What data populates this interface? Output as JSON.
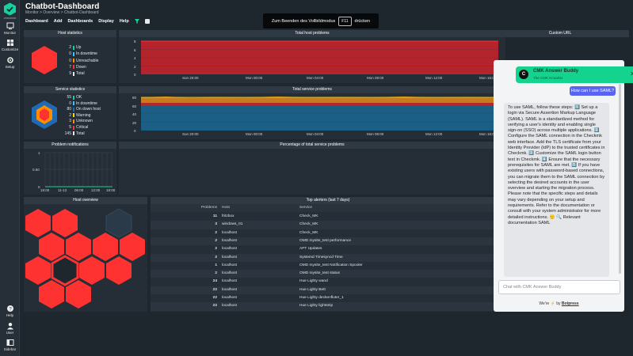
{
  "app": {
    "logo_text": "checkmk",
    "nav": [
      {
        "label": "Monitor",
        "icon": "monitor-icon"
      },
      {
        "label": "Customize",
        "icon": "customize-icon"
      },
      {
        "label": "Setup",
        "icon": "setup-icon"
      },
      {
        "label": "Help",
        "icon": "help-icon"
      },
      {
        "label": "User",
        "icon": "user-icon"
      },
      {
        "label": "Sidebar",
        "icon": "sidebar-icon"
      }
    ]
  },
  "header": {
    "title": "Chatbot-Dashboard",
    "breadcrumb": "Monitor > Overview > Chatbot-Dashboard",
    "menu": [
      "Dashboard",
      "Add",
      "Dashboards",
      "Display",
      "Help"
    ]
  },
  "fullscreen": {
    "before": "Zum Beenden des Vollbildmodus",
    "key": "F11",
    "after": "drücken"
  },
  "host_stats": {
    "title": "Host statistics",
    "rows": [
      {
        "num": "2",
        "label": "Up",
        "color": "#13d38e"
      },
      {
        "num": "0",
        "label": "In downtime",
        "color": "#3cc2ff"
      },
      {
        "num": "0",
        "label": "Unreachable",
        "color": "#ff8d00"
      },
      {
        "num": "7",
        "label": "Down",
        "color": "#ff3232"
      },
      {
        "num": "9",
        "label": "Total",
        "color": "#e8e8e8"
      }
    ]
  },
  "service_stats": {
    "title": "Service statistics",
    "rows": [
      {
        "num": "55",
        "label": "OK",
        "color": "#13d38e"
      },
      {
        "num": "0",
        "label": "In downtime",
        "color": "#3cc2ff"
      },
      {
        "num": "80",
        "label": "On down host",
        "color": "#1d6bb5"
      },
      {
        "num": "2",
        "label": "Warning",
        "color": "#ffd703"
      },
      {
        "num": "3",
        "label": "Unknown",
        "color": "#ff8d00"
      },
      {
        "num": "5",
        "label": "Critical",
        "color": "#ff3232"
      },
      {
        "num": "145",
        "label": "Total",
        "color": "#e8e8e8"
      }
    ]
  },
  "total_host": {
    "title": "Total host problems",
    "yticks": [
      "8",
      "6",
      "4",
      "2",
      "0"
    ],
    "xticks": [
      "Sun 20:00",
      "Mon 00:00",
      "Mon 04:00",
      "Mon 08:00",
      "Mon 12:00",
      "Mon 16:00"
    ]
  },
  "total_service": {
    "title": "Total service problems",
    "yticks": [
      "80",
      "60",
      "40",
      "20",
      "0"
    ],
    "xticks": [
      "Sun 20:00",
      "Mon 00:00",
      "Mon 04:00",
      "Mon 08:00",
      "Mon 12:00",
      "Mon 16:00"
    ]
  },
  "problem_notifications": {
    "title": "Problem notifications",
    "yticks": [
      "1",
      "0.50",
      "0"
    ],
    "xticks": [
      "18:00",
      "11-13",
      "06:00",
      "12:00",
      "18:00"
    ]
  },
  "percentage": {
    "title": "Percentage of total service problems"
  },
  "host_overview": {
    "title": "Host overview"
  },
  "custom_url": {
    "title": "Custom URL"
  },
  "top_alerters": {
    "title": "Top alerters (last 7 days)",
    "columns": [
      "Problems",
      "Host",
      "Service"
    ],
    "rows": [
      [
        "11",
        "fritzbox",
        "Check_MK"
      ],
      [
        "3",
        "windows_01",
        "Check_MK"
      ],
      [
        "2",
        "localhost",
        "Check_MK"
      ],
      [
        "2",
        "localhost",
        "OMD mysite_test performance"
      ],
      [
        "2",
        "localhost",
        "APT Updates"
      ],
      [
        "2",
        "localhost",
        "Systemd Timesyncd Time"
      ],
      [
        "1",
        "localhost",
        "OMD mysite_test Notification Spooler"
      ],
      [
        "2",
        "localhost",
        "OMD mysite_test status"
      ],
      [
        "24",
        "localhost",
        "Hue Lighty wand"
      ],
      [
        "22",
        "localhost",
        "Hue Lighty Bett"
      ],
      [
        "22",
        "localhost",
        "Hue Lighty deckenfluter_1"
      ],
      [
        "22",
        "localhost",
        "Hue Lighty lightstrip"
      ],
      [
        "22",
        "localhost",
        "Hue Lighty deckenfluter_2"
      ]
    ]
  },
  "chat": {
    "bot_name": "CMK Answer Buddy",
    "bot_sub": "The CMK Knowlist",
    "avatar": "C",
    "user_message": "How can I use SAML?",
    "bot_message": "To use SAML, follow these steps: 1️⃣ Set up a login via Secure Assertion Markup Language (SAML). SAML is a standardized method for verifying a user's identity and enabling single sign-on (SSO) across multiple applications. 2️⃣ Configure the SAML connection in the Checkmk web interface. Add the TLS certificate from your Identity Provider (IdP) to the trusted certificates in Checkmk. 3️⃣ Customize the SAML login button text in Checkmk. 4️⃣ Ensure that the necessary prerequisites for SAML are met. 5️⃣ If you have existing users with password-based connections, you can migrate them to the SAML connection by selecting the desired accounts in the user overview and starting the migration process. Please note that the specific steps and details may vary depending on your setup and requirements. Refer to the documentation or consult with your system administrator for more detailed instructions. 🙂 🔍 Relevant documentation SAML",
    "input_placeholder": "Chat with CMK Answer Buddy",
    "footer_prefix": "We're ⚡ by",
    "footer_brand": "Botpress"
  }
}
